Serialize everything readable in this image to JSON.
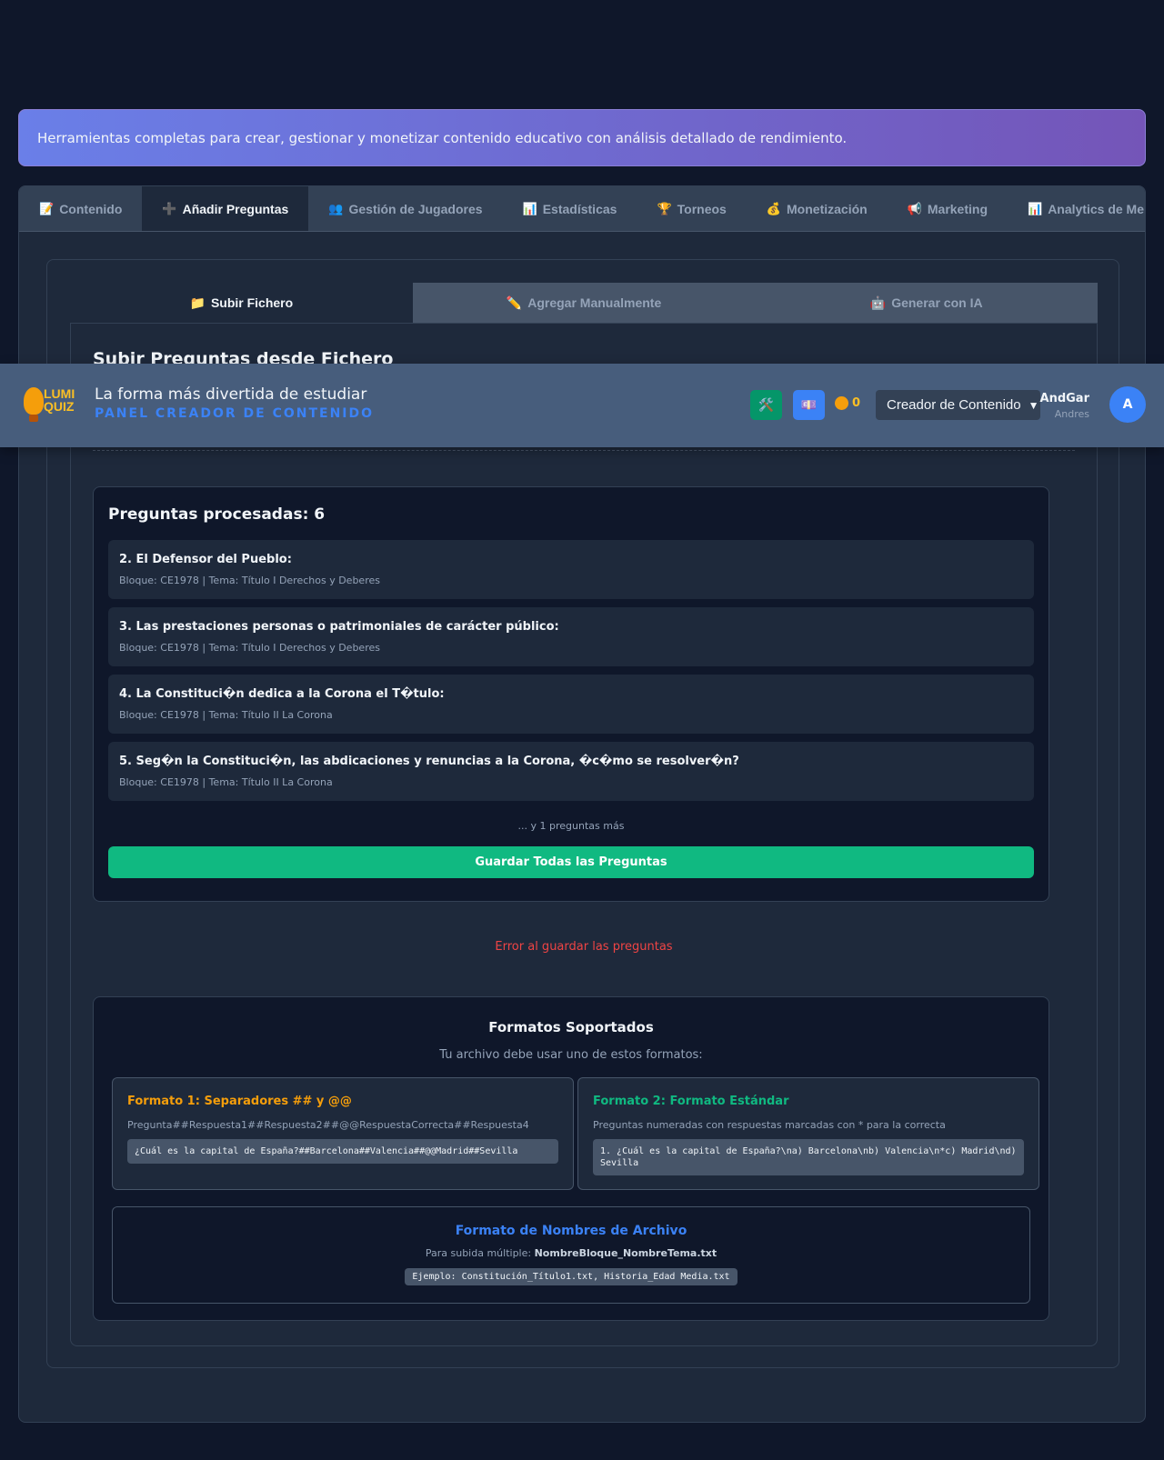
{
  "banner": {
    "text": "Herramientas completas para crear, gestionar y monetizar contenido educativo con análisis detallado de rendimiento."
  },
  "tabs": [
    {
      "icon": "📝",
      "label": "Contenido"
    },
    {
      "icon": "➕",
      "label": "Añadir Preguntas"
    },
    {
      "icon": "👥",
      "label": "Gestión de Jugadores"
    },
    {
      "icon": "📊",
      "label": "Estadísticas"
    },
    {
      "icon": "🏆",
      "label": "Torneos"
    },
    {
      "icon": "💰",
      "label": "Monetización"
    },
    {
      "icon": "📢",
      "label": "Marketing"
    },
    {
      "icon": "📊",
      "label": "Analytics de Merca"
    }
  ],
  "subtabs": [
    {
      "icon": "📁",
      "label": "Subir Fichero"
    },
    {
      "icon": "✏️",
      "label": "Agregar Manualmente"
    },
    {
      "icon": "🤖",
      "label": "Generar con IA"
    }
  ],
  "panel": {
    "title": "Subir Preguntas desde Fichero"
  },
  "processed": {
    "title": "Preguntas procesadas: 6",
    "questions": [
      {
        "text": "2. El Defensor del Pueblo:",
        "meta": "Bloque: CE1978 | Tema: Título I Derechos y Deberes"
      },
      {
        "text": "3. Las prestaciones personas o patrimoniales de carácter público:",
        "meta": "Bloque: CE1978 | Tema: Título I Derechos y Deberes"
      },
      {
        "text": "4. La Constituci�n dedica a la Corona el T�tulo:",
        "meta": "Bloque: CE1978 | Tema: Título II La Corona"
      },
      {
        "text": "5. Seg�n la Constituci�n, las abdicaciones y renuncias a la Corona, �c�mo se resolver�n?",
        "meta": "Bloque: CE1978 | Tema: Título II La Corona"
      }
    ],
    "more": "... y 1 preguntas más",
    "save_label": "Guardar Todas las Preguntas"
  },
  "error": "Error al guardar las preguntas",
  "formats": {
    "title": "Formatos Soportados",
    "subtitle": "Tu archivo debe usar uno de estos formatos:",
    "f1": {
      "title": "Formato 1: Separadores ## y @@",
      "desc": "Pregunta##Respuesta1##Respuesta2##@@RespuestaCorrecta##Respuesta4",
      "example": "¿Cuál es la capital de España?##Barcelona##Valencia##@@Madrid##Sevilla",
      "color": "#f59e0b"
    },
    "f2": {
      "title": "Formato 2: Formato Estándar",
      "desc": "Preguntas numeradas con respuestas marcadas con * para la correcta",
      "example": "1. ¿Cuál es la capital de España?\\na) Barcelona\\nb) Valencia\\n*c) Madrid\\nd) Sevilla",
      "color": "#10b981"
    },
    "names": {
      "title": "Formato de Nombres de Archivo",
      "desc_prefix": "Para subida múltiple: ",
      "desc_bold": "NombreBloque_NombreTema.txt",
      "example": "Ejemplo: Constitución_Título1.txt, Historia_Edad Media.txt"
    }
  },
  "header": {
    "logo_text": "LUMI QUIZ",
    "tagline": "La forma más divertida de estudiar",
    "panel_label": "PANEL CREADOR DE CONTENIDO",
    "btn1_icon": "🛠️",
    "btn2_icon": "💷",
    "coins": "0",
    "role": "Creador de Contenido",
    "user_name": "AndGar",
    "user_sub": "Andres",
    "avatar_initial": "A"
  }
}
